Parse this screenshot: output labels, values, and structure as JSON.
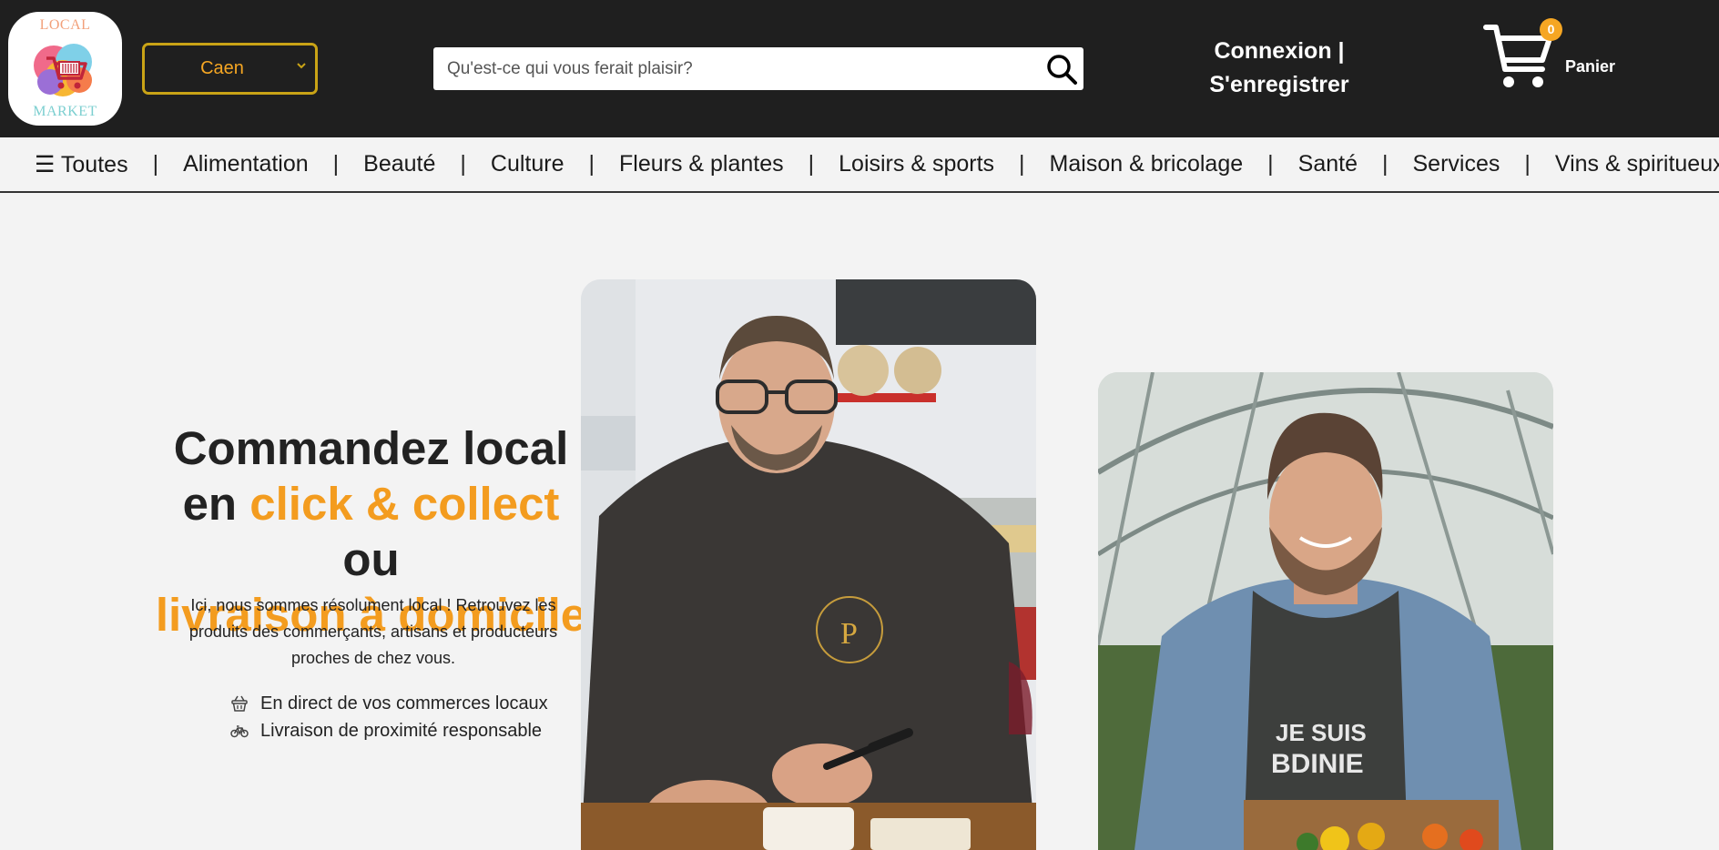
{
  "header": {
    "logo": {
      "top_text": "LOCAL",
      "bottom_text": "MARKET"
    },
    "city_select": {
      "selected": "Caen"
    },
    "search": {
      "placeholder": "Qu'est-ce qui vous ferait plaisir?"
    },
    "auth": {
      "line1": "Connexion |",
      "line2": "S'enregistrer"
    },
    "cart": {
      "count": "0",
      "label": "Panier"
    }
  },
  "categories": [
    {
      "label": "☰ Toutes"
    },
    {
      "label": "Alimentation"
    },
    {
      "label": "Beauté"
    },
    {
      "label": "Culture"
    },
    {
      "label": "Fleurs & plantes"
    },
    {
      "label": "Loisirs & sports"
    },
    {
      "label": "Maison & bricolage"
    },
    {
      "label": "Santé"
    },
    {
      "label": "Services"
    },
    {
      "label": "Vins & spiritueux"
    }
  ],
  "category_separator": "|",
  "hero": {
    "title_part1": "Commandez local",
    "title_part2": "en ",
    "title_part3": "click & collect",
    "title_part4": " ou",
    "title_part5": "livraison à domicile",
    "description": "Ici, nous sommes résolument local ! Retrouvez les produits des commerçants, artisans et producteurs proches de chez vous.",
    "features": [
      {
        "icon": "basket-icon",
        "text": "En direct de vos commerces locaux"
      },
      {
        "icon": "bicycle-icon",
        "text": "Livraison de proximité responsable"
      }
    ]
  },
  "colors": {
    "accent": "#f39c1f",
    "header_bg": "#1f1f1f",
    "page_bg": "#f3f3f3",
    "select_border": "#c9a316"
  }
}
